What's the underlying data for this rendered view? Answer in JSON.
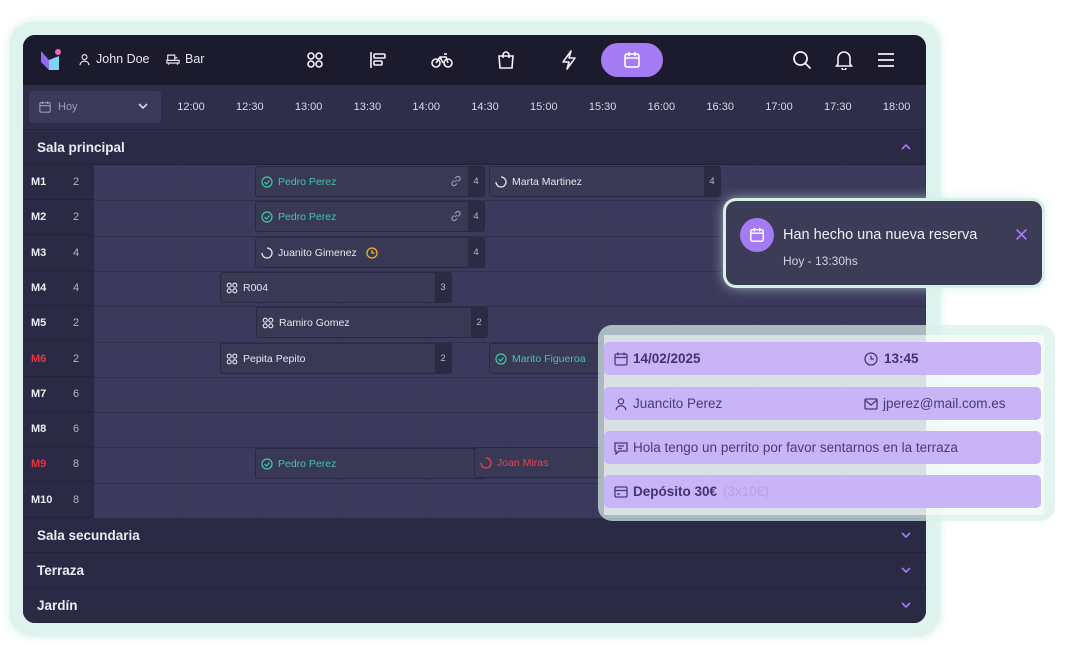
{
  "topbar": {
    "user_name": "John Doe",
    "venue": "Bar",
    "nav_icons": [
      "apps-icon",
      "list-icon",
      "bike-icon",
      "bag-icon",
      "bolt-icon",
      "calendar-icon"
    ],
    "active_nav": "calendar-icon"
  },
  "date_selector": {
    "label": "Hoy"
  },
  "time_ticks": [
    "12:00",
    "12:30",
    "13:00",
    "13:30",
    "14:00",
    "14:30",
    "15:00",
    "15:30",
    "16:00",
    "16:30",
    "17:00",
    "17:30",
    "18:00"
  ],
  "sections": {
    "main": "Sala principal",
    "secondary": "Sala secundaria",
    "terrace": "Terraza",
    "garden": "Jardín"
  },
  "tables": [
    {
      "name": "M1",
      "capacity": "2"
    },
    {
      "name": "M2",
      "capacity": "2"
    },
    {
      "name": "M3",
      "capacity": "4"
    },
    {
      "name": "M4",
      "capacity": "4"
    },
    {
      "name": "M5",
      "capacity": "2"
    },
    {
      "name": "M6",
      "capacity": "2"
    },
    {
      "name": "M7",
      "capacity": "6"
    },
    {
      "name": "M8",
      "capacity": "6"
    },
    {
      "name": "M9",
      "capacity": "8"
    },
    {
      "name": "M10",
      "capacity": "8"
    }
  ],
  "reservations": {
    "m1a": {
      "name": "Pedro Perez",
      "count": "4"
    },
    "m1b": {
      "name": "Marta Martinez",
      "count": "4"
    },
    "m2a": {
      "name": "Pedro Perez",
      "count": "4"
    },
    "m3a": {
      "name": "Juanito Gimenez",
      "count": "4"
    },
    "m4a": {
      "name": "R004",
      "count": "3"
    },
    "m5a": {
      "name": "Ramiro Gomez",
      "count": "2"
    },
    "m6a": {
      "name": "Pepita Pepito",
      "count": "2"
    },
    "m6b": {
      "name": "Marito Figueroa"
    },
    "m9a": {
      "name": "Pedro Perez"
    },
    "m9b": {
      "name": "Joan Miras"
    }
  },
  "notification": {
    "title": "Han hecho una nueva reserva",
    "subtitle": "Hoy - 13:30hs"
  },
  "details": {
    "date": "14/02/2025",
    "time": "13:45",
    "customer": "Juancito Perez",
    "email": "jperez@mail.com.es",
    "note": "Hola tengo un perrito por favor sentarnos en la terraza",
    "deposit": "Depósito 30€",
    "deposit_detail": "(3x10€)"
  },
  "colors": {
    "accent": "#a57bf3",
    "confirmed": "#3fc7a8",
    "alert": "#e8333f",
    "pending": "#f0b429"
  }
}
